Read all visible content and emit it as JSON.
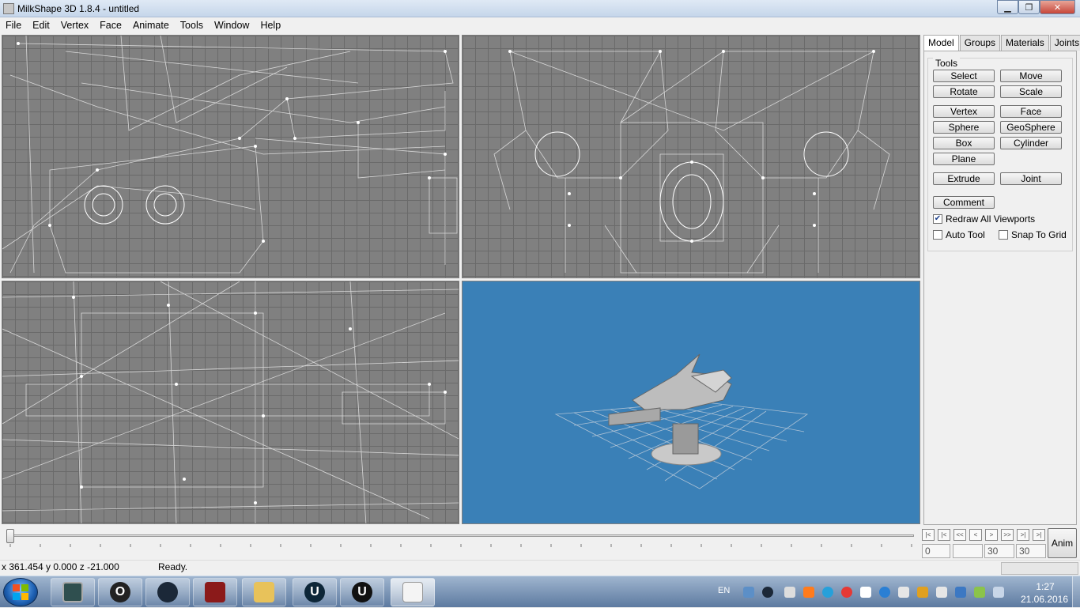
{
  "window": {
    "title": "MilkShape 3D 1.8.4 - untitled",
    "controls": {
      "minimize": "▁",
      "maximize": "❐",
      "close": "✕"
    }
  },
  "menu": [
    "File",
    "Edit",
    "Vertex",
    "Face",
    "Animate",
    "Tools",
    "Window",
    "Help"
  ],
  "panel": {
    "tabs": [
      {
        "label": "Model",
        "active": true
      },
      {
        "label": "Groups",
        "active": false
      },
      {
        "label": "Materials",
        "active": false
      },
      {
        "label": "Joints",
        "active": false
      }
    ],
    "tools_legend": "Tools",
    "buttons": {
      "select": "Select",
      "move": "Move",
      "rotate": "Rotate",
      "scale": "Scale",
      "vertex": "Vertex",
      "face": "Face",
      "sphere": "Sphere",
      "geosphere": "GeoSphere",
      "box": "Box",
      "cylinder": "Cylinder",
      "plane": "Plane",
      "extrude": "Extrude",
      "joint": "Joint",
      "comment": "Comment"
    },
    "checkboxes": {
      "redraw_all": {
        "label": "Redraw All Viewports",
        "checked": true
      },
      "auto_tool": {
        "label": "Auto Tool",
        "checked": false
      },
      "snap_grid": {
        "label": "Snap To Grid",
        "checked": false
      }
    }
  },
  "timeline": {
    "nav": [
      "|<",
      "|<",
      "<<",
      "<",
      ">",
      ">>",
      ">|",
      ">|"
    ],
    "fields": {
      "current": "0",
      "blank": "",
      "start": "30",
      "end": "30"
    },
    "anim_label": "Anim"
  },
  "status": {
    "coords": "x 361.454 y 0.000 z -21.000",
    "message": "Ready."
  },
  "taskbar": {
    "language": "EN",
    "time": "1:27",
    "date": "21.06.2016",
    "apps": [
      "computer-monitor-icon",
      "opera-icon",
      "steam-icon",
      "game-icon",
      "file-explorer-icon",
      "unreal-engine-icon",
      "unreal-engine-icon",
      "milkshape-icon"
    ]
  },
  "colors": {
    "viewport_grid": "#808080",
    "viewport_3d": "#3a80b7",
    "wire": "#e8e8e8"
  }
}
